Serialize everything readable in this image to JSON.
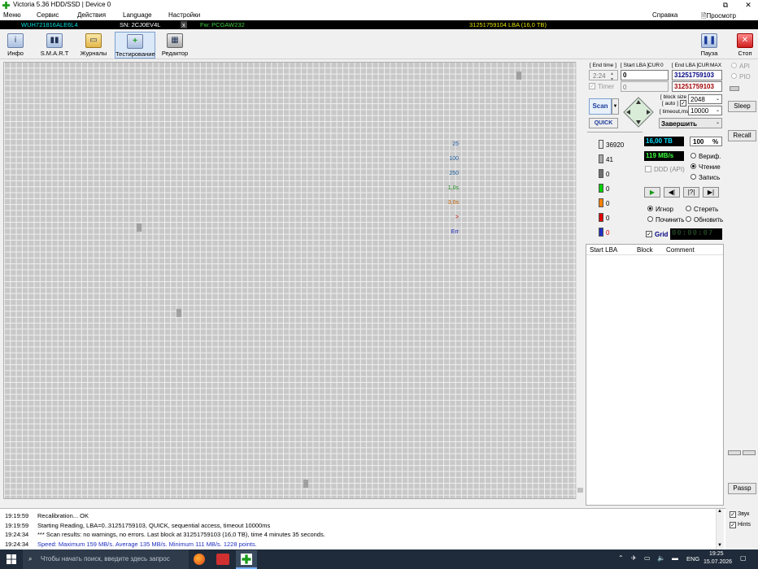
{
  "window": {
    "title": "Victoria 5.36 HDD/SSD | Device 0"
  },
  "menu": {
    "items": [
      "Меню",
      "Сервис",
      "Действия",
      "Language",
      "Настройки"
    ],
    "help": "Справка",
    "clipboard": "Просмотр буфера"
  },
  "status": {
    "model": "WUH721816ALE6L4",
    "sn": "SN: 2CJ0EV4L",
    "x": "x",
    "fw": "Fw: PCGAW232",
    "lba": "31251759104 LBA (16,0 TB)"
  },
  "toolbar": {
    "info": "Инфо",
    "smart": "S.M.A.R.T",
    "logs": "Журналы",
    "test": "Тестирование",
    "editor": "Редактор",
    "pause": "Пауза",
    "stop": "Стоп"
  },
  "panel": {
    "end_time_label": "[ End time ]",
    "start_lba_label": "[ Start LBA ]",
    "cur_label": "CUR",
    "zero": "0",
    "end_lba_label": "[ End LBA ]",
    "max_label": "MAX",
    "time_value": "2:24",
    "start_lba": "0",
    "end_lba": "31251759103",
    "timer_label": "Timer",
    "timer_value": "0",
    "end_lba2": "31251759103",
    "block_size_label": "[ block size ]",
    "auto_label": "[ auto ]",
    "timeout_label": "[ timeout,ms ]",
    "block_size": "2048",
    "timeout": "10000",
    "scan": "Scan",
    "quick": "QUICK",
    "finish": "Завершить",
    "capacity": "16,00 TB",
    "percent": "100",
    "percent_sign": "%",
    "speed": "119 MB/s",
    "verify": "Вериф.",
    "read": "Чтение",
    "write": "Запись",
    "ddd": "DDD (API)",
    "ignore": "Игнор",
    "erase": "Стереть",
    "repair": "Починить",
    "refresh": "Обновить",
    "grid": "Grid",
    "timer_display": "00:00:07",
    "col_start": "Start LBA",
    "col_block": "Block",
    "col_comment": "Comment",
    "sw": [
      {
        "label": "25",
        "count": "36920",
        "color": "#e8e8e8"
      },
      {
        "label": "100",
        "count": "41",
        "color": "#a8a8a8"
      },
      {
        "label": "250",
        "count": "0",
        "color": "#707070"
      },
      {
        "label": "1,0s",
        "count": "0",
        "color": "#00d000"
      },
      {
        "label": "3,0s",
        "count": "0",
        "color": "#ff8000"
      },
      {
        "label": ">",
        "count": "0",
        "color": "#e00000"
      },
      {
        "label": "Err",
        "count": "0",
        "color": "#2030c0"
      }
    ]
  },
  "side": {
    "api": "API",
    "pio": "PIO",
    "sleep": "Sleep",
    "recall": "Recall",
    "passp": "Passp",
    "sound": "Звук",
    "hints": "Hints"
  },
  "log": [
    {
      "time": "19:19:59",
      "text": "Recalibration... OK",
      "color": "#000000"
    },
    {
      "time": "19:19:59",
      "text": "Starting Reading, LBA=0..31251759103, QUICK, sequential access, timeout 10000ms",
      "color": "#000000"
    },
    {
      "time": "19:24:34",
      "text": "*** Scan results: no warnings, no errors. Last block at 31251759103 (16,0 TB), time 4 minutes 35 seconds.",
      "color": "#000000"
    },
    {
      "time": "19:24:34",
      "text": "Speed: Maximum 159 MB/s. Average 135 MB/s. Minimum 111 MB/s. 1228 points.",
      "color": "#2030c0"
    }
  ],
  "taskbar": {
    "search_placeholder": "Чтобы начать поиск, введите здесь запрос",
    "lang": "ENG",
    "time": "19:25",
    "date": "15.07.2026"
  }
}
